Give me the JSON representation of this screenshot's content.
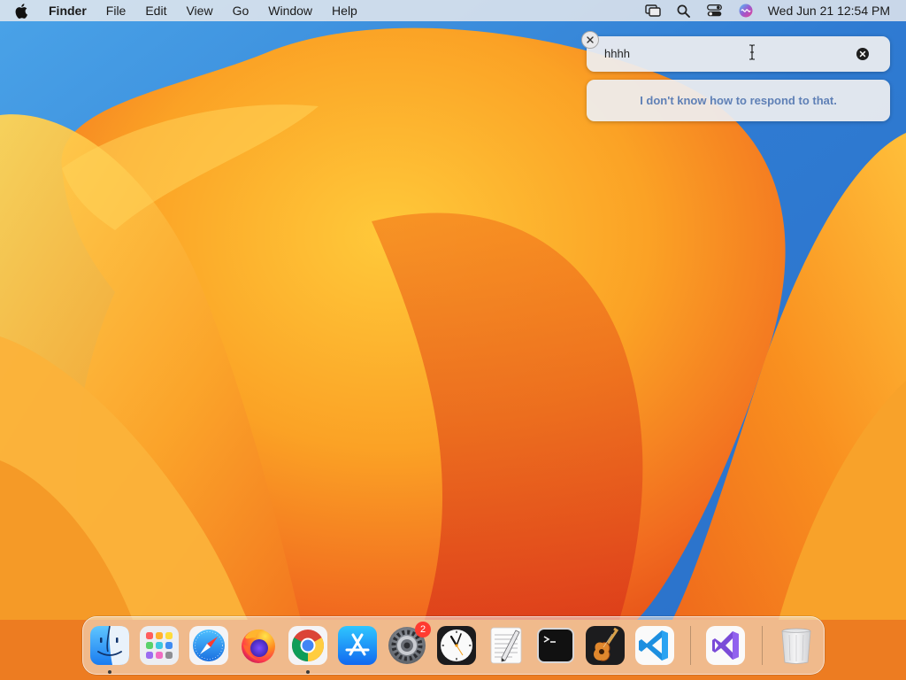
{
  "menubar": {
    "app_name": "Finder",
    "menus": [
      "File",
      "Edit",
      "View",
      "Go",
      "Window",
      "Help"
    ],
    "clock": "Wed Jun 21  12:54 PM",
    "status_icons": [
      "screen-mirroring-icon",
      "spotlight-search-icon",
      "control-center-icon",
      "siri-icon"
    ]
  },
  "siri": {
    "query": "hhhh",
    "response": "I don't know how to respond to that."
  },
  "dock": {
    "apps": [
      {
        "name": "Finder",
        "icon": "finder-icon",
        "running": true
      },
      {
        "name": "Launchpad",
        "icon": "launchpad-icon",
        "running": false
      },
      {
        "name": "Safari",
        "icon": "safari-icon",
        "running": false
      },
      {
        "name": "Firefox",
        "icon": "firefox-icon",
        "running": false
      },
      {
        "name": "Google Chrome",
        "icon": "chrome-icon",
        "running": true
      },
      {
        "name": "App Store",
        "icon": "app-store-icon",
        "running": false
      },
      {
        "name": "System Settings",
        "icon": "system-settings-icon",
        "running": false,
        "badge": "2"
      },
      {
        "name": "Clock",
        "icon": "clock-icon",
        "running": false
      },
      {
        "name": "TextEdit",
        "icon": "textedit-icon",
        "running": false
      },
      {
        "name": "Terminal",
        "icon": "terminal-icon",
        "running": false
      },
      {
        "name": "GarageBand",
        "icon": "garageband-icon",
        "running": false
      },
      {
        "name": "Visual Studio Code",
        "icon": "vscode-icon",
        "running": false
      },
      {
        "name": "Visual Studio",
        "icon": "visual-studio-icon",
        "running": false
      },
      {
        "name": "Trash",
        "icon": "trash-icon",
        "running": false
      }
    ]
  },
  "colors": {
    "wallpaper_blue": "#3b82d6",
    "wallpaper_orange": "#f7a21c",
    "siri_response_text": "#5f80b6",
    "badge_red": "#ff3b30"
  }
}
